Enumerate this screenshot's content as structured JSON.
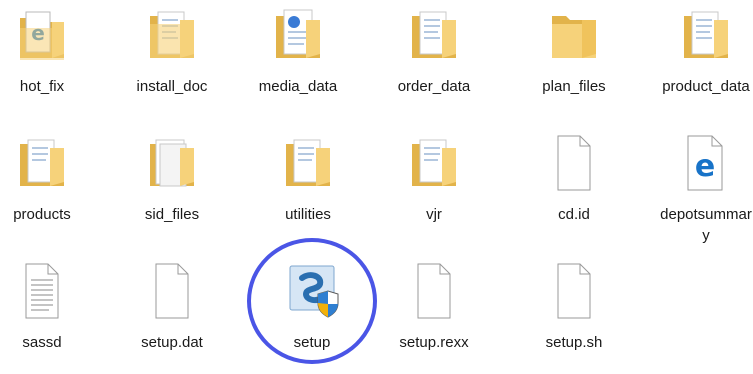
{
  "colors": {
    "folder_back": "#e2b34a",
    "folder_front": "#f6d27a",
    "folder_shadow": "#d8a43a",
    "highlight_ring": "#4a55e6",
    "edge_blue": "#1873c8",
    "setup_blue": "#2a6fb0"
  },
  "items": [
    {
      "label": "hot_fix",
      "icon": "folder-with-edge-document-icon"
    },
    {
      "label": "install_doc",
      "icon": "folder-with-documents-icon"
    },
    {
      "label": "media_data",
      "icon": "folder-with-media-document-icon"
    },
    {
      "label": "order_data",
      "icon": "folder-with-documents-icon"
    },
    {
      "label": "plan_files",
      "icon": "folder-icon"
    },
    {
      "label": "product_data",
      "icon": "folder-with-documents-icon"
    },
    {
      "label": "products",
      "icon": "folder-with-documents-icon"
    },
    {
      "label": "sid_files",
      "icon": "folder-with-white-documents-icon"
    },
    {
      "label": "utilities",
      "icon": "folder-with-documents-icon"
    },
    {
      "label": "vjr",
      "icon": "folder-with-documents-icon"
    },
    {
      "label": "cd.id",
      "icon": "blank-file-icon"
    },
    {
      "label": "depotsummary",
      "icon": "edge-html-file-icon"
    },
    {
      "label": "sassd",
      "icon": "text-file-icon"
    },
    {
      "label": "setup.dat",
      "icon": "blank-file-icon"
    },
    {
      "label": "setup",
      "icon": "setup-shield-app-icon"
    },
    {
      "label": "setup.rexx",
      "icon": "blank-file-icon"
    },
    {
      "label": "setup.sh",
      "icon": "blank-file-icon"
    }
  ]
}
